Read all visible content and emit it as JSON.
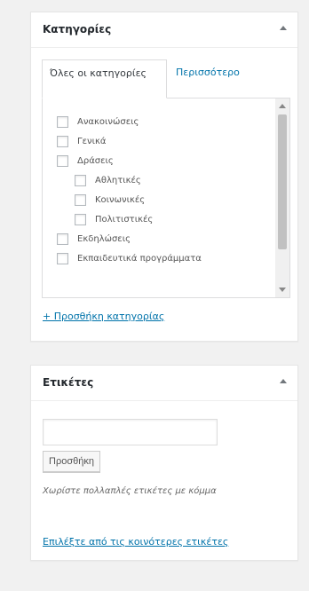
{
  "categories_box": {
    "title": "Κατηγορίες",
    "tab_all": "Όλες οι κατηγορίες",
    "tab_popular": "Περισσότερο χρησιμοποιημένες",
    "items": [
      {
        "label": "Ανακοινώσεις",
        "checked": false,
        "level": 0
      },
      {
        "label": "Γενικά",
        "checked": false,
        "level": 0
      },
      {
        "label": "Δράσεις",
        "checked": false,
        "level": 0
      },
      {
        "label": "Αθλητικές",
        "checked": false,
        "level": 1
      },
      {
        "label": "Κοινωνικές",
        "checked": false,
        "level": 1
      },
      {
        "label": "Πολιτιστικές",
        "checked": false,
        "level": 1
      },
      {
        "label": "Εκδηλώσεις",
        "checked": false,
        "level": 0
      },
      {
        "label": "Εκπαιδευτικά προγράμματα",
        "checked": false,
        "level": 0
      }
    ],
    "add_link": "+ Προσθήκη κατηγορίας"
  },
  "tags_box": {
    "title": "Ετικέτες",
    "input_value": "",
    "add_button": "Προσθήκη",
    "hint": "Χωρίστε πολλαπλές ετικέτες με κόμμα",
    "cloud_link": "Επιλέξτε από τις κοινότερες ετικέτες"
  },
  "icons": {
    "toggle": "triangle-up-icon",
    "scroll_up": "scroll-up-arrow-icon",
    "scroll_down": "scroll-down-arrow-icon"
  },
  "colors": {
    "link": "#0073aa",
    "background": "#f1f1f1",
    "border": "#e5e5e5"
  }
}
